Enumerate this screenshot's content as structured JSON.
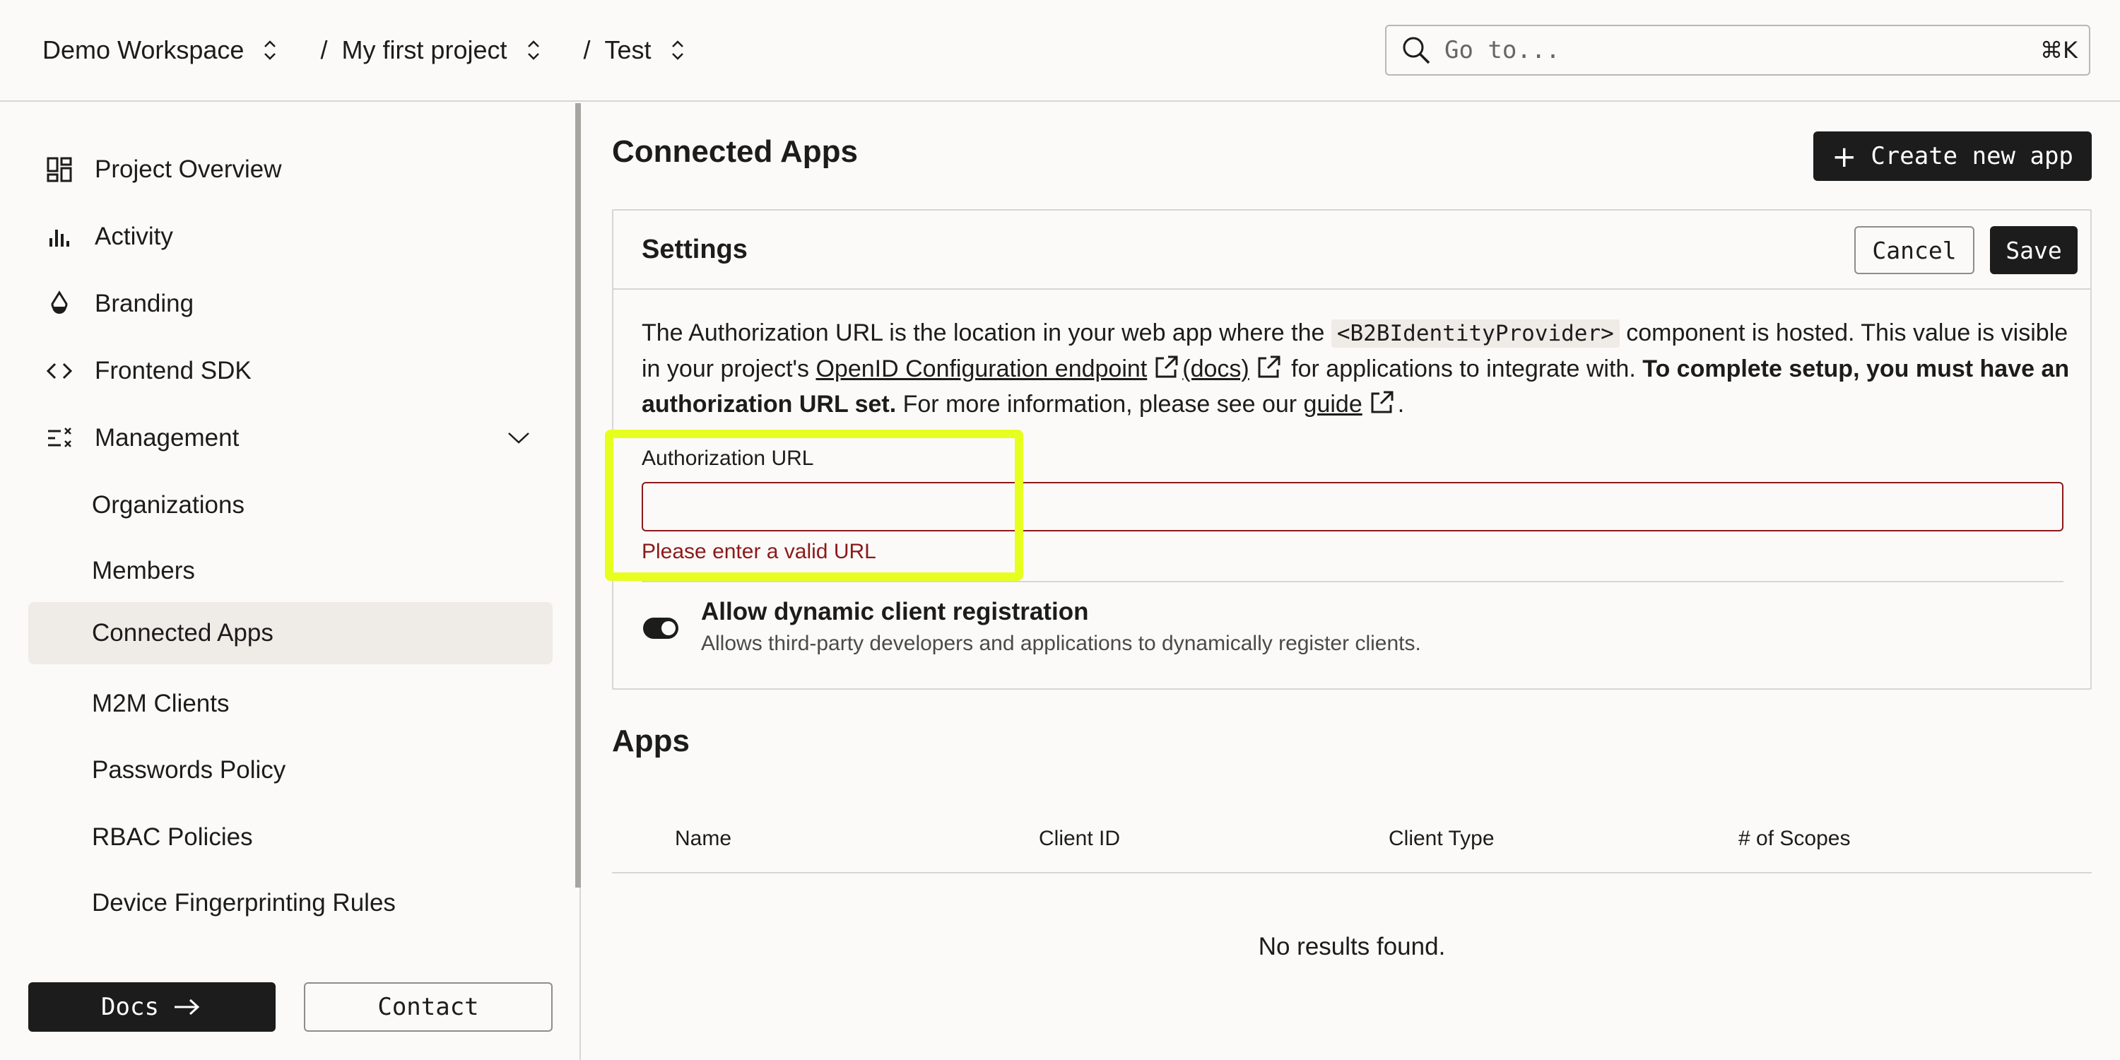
{
  "breadcrumb": {
    "workspace": "Demo Workspace",
    "project": "My first project",
    "environment": "Test",
    "separator": "/"
  },
  "search": {
    "placeholder": "Go to...",
    "shortcut": "⌘K"
  },
  "sidebar": {
    "items": [
      {
        "label": "Project Overview",
        "icon": "dashboard-icon"
      },
      {
        "label": "Activity",
        "icon": "bar-chart-icon"
      },
      {
        "label": "Branding",
        "icon": "drop-icon"
      },
      {
        "label": "Frontend SDK",
        "icon": "code-icon"
      },
      {
        "label": "Management",
        "icon": "management-icon",
        "expanded": true
      },
      {
        "label": "Organizations"
      },
      {
        "label": "Members"
      },
      {
        "label": "Connected Apps",
        "active": true
      },
      {
        "label": "M2M Clients"
      },
      {
        "label": "Passwords Policy"
      },
      {
        "label": "RBAC Policies"
      },
      {
        "label": "Device Fingerprinting Rules"
      }
    ],
    "docs_label": "Docs",
    "contact_label": "Contact"
  },
  "main": {
    "title": "Connected Apps",
    "create_label": "Create new app",
    "settings": {
      "title": "Settings",
      "cancel_label": "Cancel",
      "save_label": "Save",
      "desc_part1": "The Authorization URL is the location in your web app where the ",
      "desc_code": "<B2BIdentityProvider>",
      "desc_part2": " component is hosted. This value is visible in your project's ",
      "desc_link1": "OpenID Configuration endpoint",
      "desc_link2": "(docs)",
      "desc_part3": " for applications to integrate with. ",
      "desc_bold": "To complete setup, you must have an authorization URL set.",
      "desc_part4": " For more information, please see our ",
      "desc_link3": "guide",
      "desc_end": ".",
      "field_label": "Authorization URL",
      "field_value": "",
      "field_error": "Please enter a valid URL",
      "toggle_title": "Allow dynamic client registration",
      "toggle_desc": "Allows third-party developers and applications to dynamically register clients.",
      "toggle_on": true
    },
    "apps": {
      "title": "Apps",
      "columns": [
        "Name",
        "Client ID",
        "Client Type",
        "# of Scopes"
      ],
      "empty": "No results found."
    }
  },
  "colors": {
    "accent": "#1c1c1c",
    "error": "#8b1a1a",
    "highlight": "#e6ff1f",
    "background": "#fbfaf8"
  }
}
